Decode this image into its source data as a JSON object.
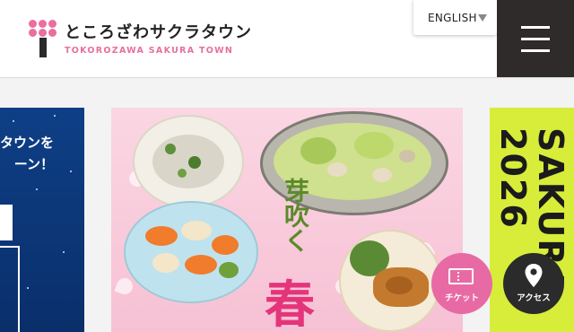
{
  "header": {
    "logo_jp": "ところざわサクラタウン",
    "logo_en": "TOKOROZAWA SAKURA TOWN",
    "language_label": "ENGLISH"
  },
  "carousel": {
    "left_slide_lines": [
      "タウンを",
      "ーン！"
    ],
    "main_slide_vertical": "芽吹く",
    "main_slide_large": "春",
    "right_slide_lines": [
      "SAKURA",
      "2026"
    ]
  },
  "fab": {
    "ticket_label": "チケット",
    "access_label": "アクセス"
  },
  "colors": {
    "brand_pink": "#e86f9e",
    "menu_dark": "#2e2b2a",
    "slide_blue": "#0e3f86",
    "slide_lime": "#d8ec3a"
  },
  "icons": [
    "sakura-logo-icon",
    "caret-down-icon",
    "hamburger-icon",
    "ticket-icon",
    "map-pin-icon"
  ]
}
